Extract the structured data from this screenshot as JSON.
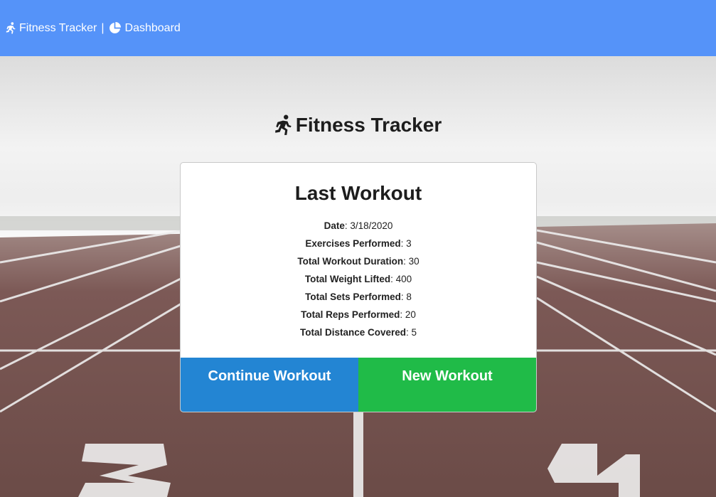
{
  "nav": {
    "brand_label": "Fitness Tracker",
    "separator": "|",
    "dashboard_label": "Dashboard"
  },
  "heading": "Fitness Tracker",
  "card": {
    "title": "Last Workout",
    "stats": [
      {
        "label": "Date",
        "value": "3/18/2020"
      },
      {
        "label": "Exercises Performed",
        "value": "3"
      },
      {
        "label": "Total Workout Duration",
        "value": "30"
      },
      {
        "label": "Total Weight Lifted",
        "value": "400"
      },
      {
        "label": "Total Sets Performed",
        "value": "8"
      },
      {
        "label": "Total Reps Performed",
        "value": "20"
      },
      {
        "label": "Total Distance Covered",
        "value": "5"
      }
    ],
    "continue_label": "Continue Workout",
    "new_label": "New Workout"
  },
  "colors": {
    "navbar": "#5593f9",
    "continue_button": "#2385d3",
    "new_button": "#20bb48"
  },
  "icons": {
    "brand": "running-person-icon",
    "dashboard": "pie-chart-icon",
    "heading": "running-person-icon"
  }
}
